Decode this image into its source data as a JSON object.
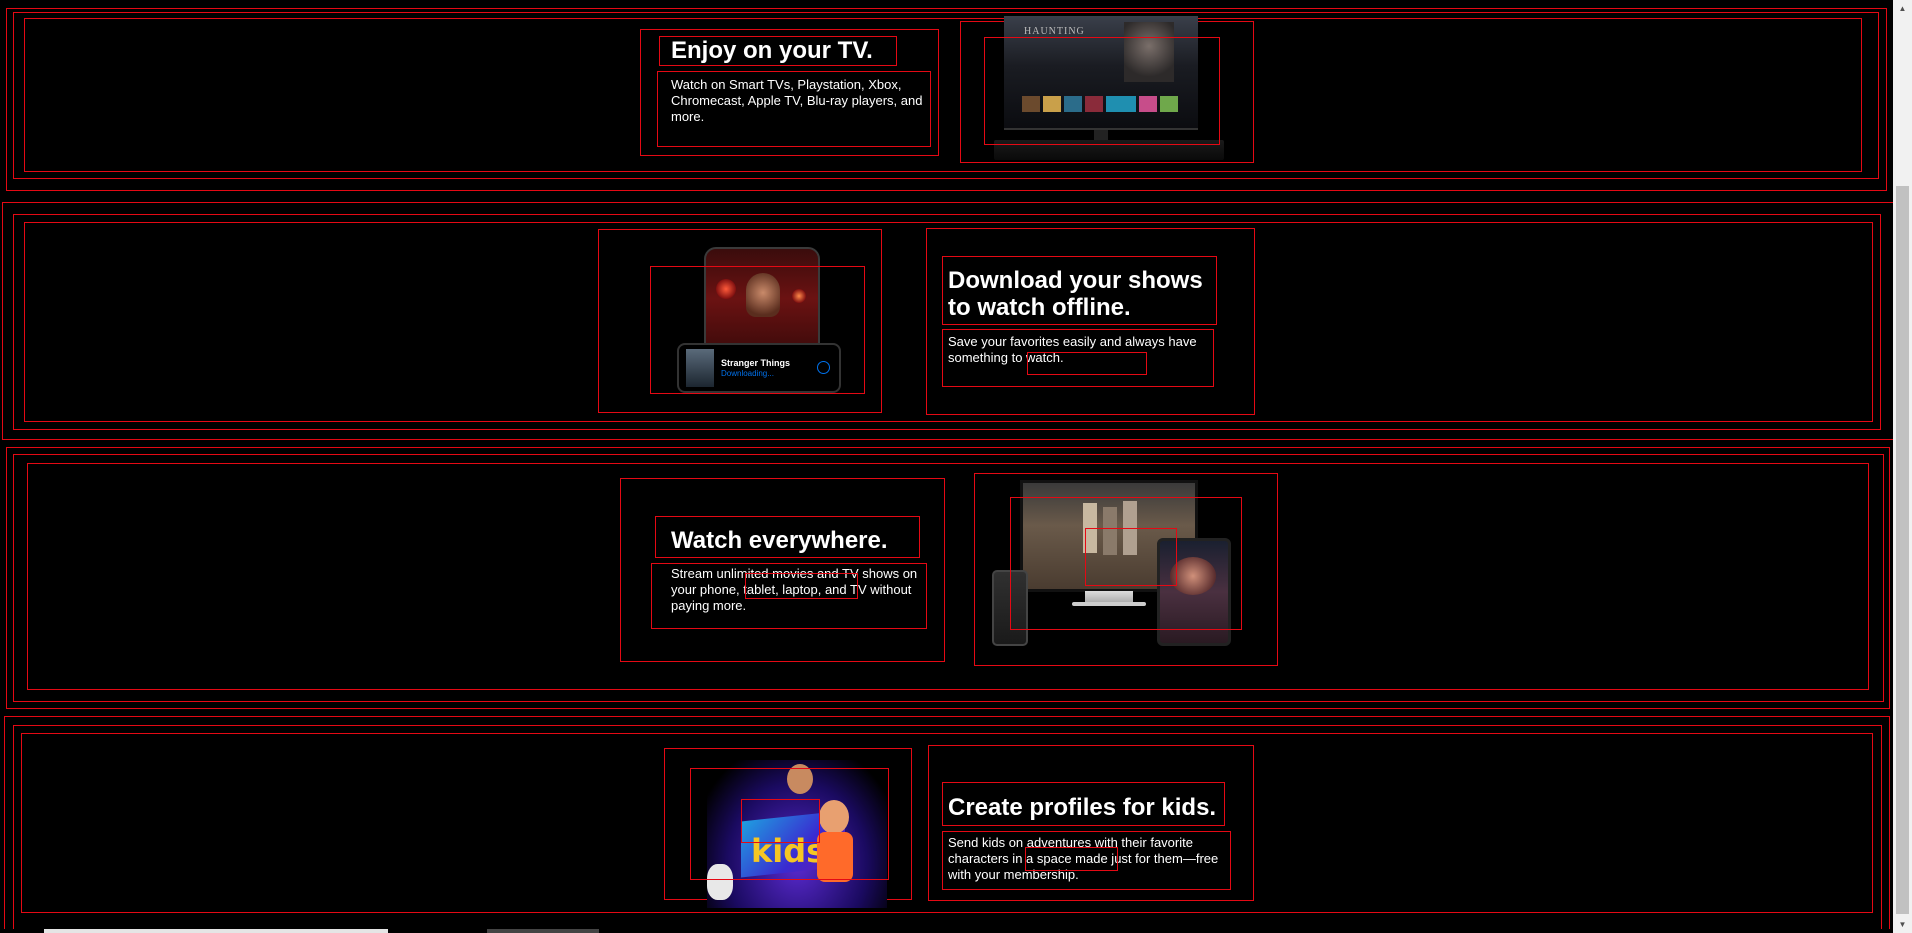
{
  "sections": [
    {
      "title": "Enjoy on your TV.",
      "description": "Watch on Smart TVs, Playstation, Xbox, Chromecast, Apple TV, Blu-ray players, and more.",
      "image": "tv-with-show-image",
      "screen_text": "HAUNTING"
    },
    {
      "title": "Download your shows to watch offline.",
      "description": "Save your favorites easily and always have something to watch.",
      "image": "phone-download-image",
      "download_card": {
        "show_title": "Stranger Things",
        "status": "Downloading..."
      }
    },
    {
      "title": "Watch everywhere.",
      "description": "Stream unlimited movies and TV shows on your phone, tablet, laptop, and TV without paying more.",
      "image": "multi-device-image"
    },
    {
      "title": "Create profiles for kids.",
      "description": "Send kids on adventures with their favorite characters in a space made just for them—free with your membership.",
      "image": "kids-profile-image",
      "kids_label": "kids"
    }
  ],
  "colors": {
    "background": "#000000",
    "outline": "#e50914",
    "text": "#ffffff",
    "download_status": "#0071eb"
  },
  "icons": [
    "scroll-up-arrow-icon",
    "scroll-down-arrow-icon",
    "download-progress-icon"
  ]
}
